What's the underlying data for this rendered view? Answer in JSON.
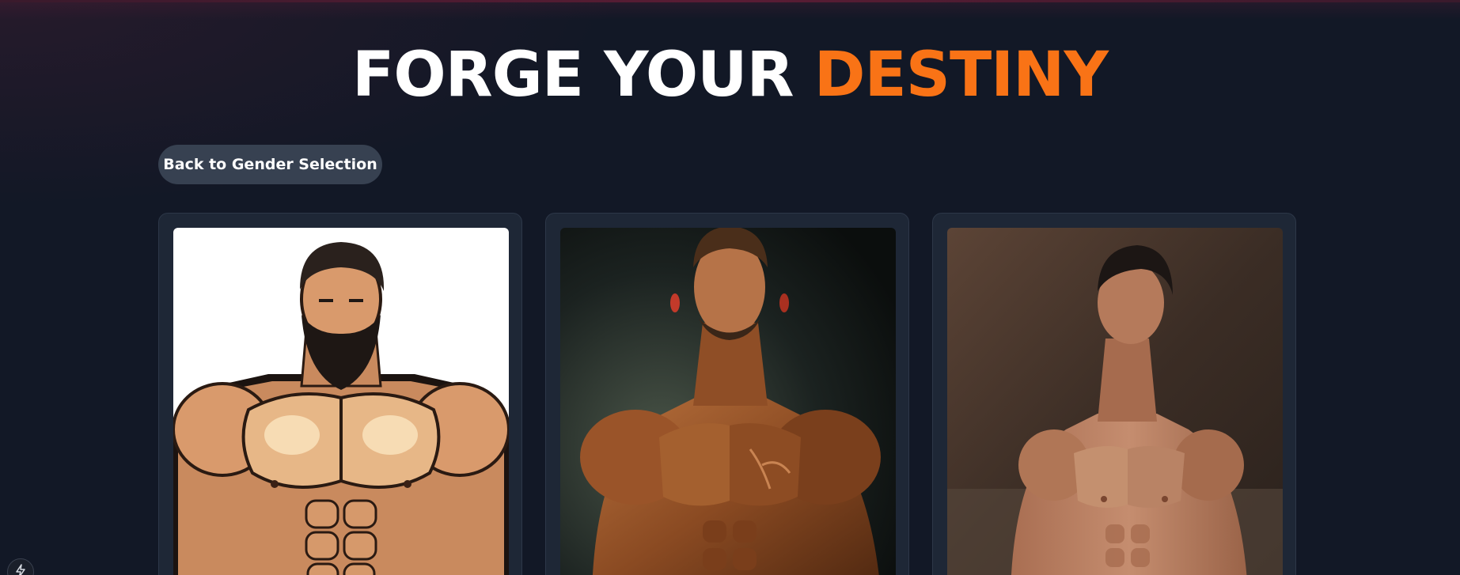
{
  "header": {
    "title_main": "FORGE YOUR",
    "title_accent": "DESTINY",
    "accent_color": "#f97316"
  },
  "navigation": {
    "back_label": "Back to Gender Selection"
  },
  "options": [
    {
      "style": "cartoon illustration",
      "subject": "bearded muscular man"
    },
    {
      "style": "dramatic digital art",
      "subject": "bodybuilder with veins"
    },
    {
      "style": "photographic",
      "subject": "athletic man in profile"
    }
  ],
  "icons": {
    "corner": "lightning-bolt-icon"
  }
}
